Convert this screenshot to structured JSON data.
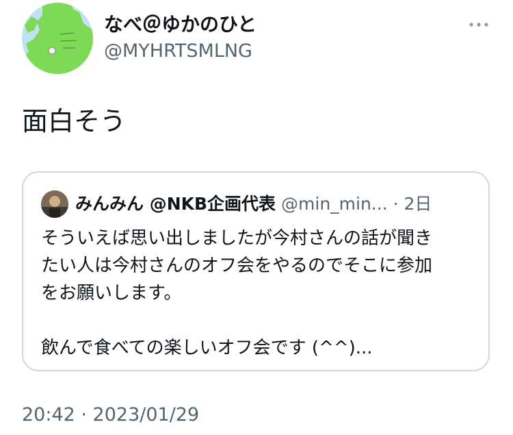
{
  "author": {
    "display_name": "なべ＠ゆかのひと",
    "handle": "@MYHRTSMLNG",
    "avatar_icon": "map-avatar-icon"
  },
  "tweet": {
    "text": "面白そう",
    "timestamp": "20:42 · 2023/01/29"
  },
  "quoted_tweet": {
    "display_name": "みんみん @NKB企画代表",
    "handle": "@min_min...",
    "separator": "·",
    "time": "2日",
    "lines": [
      "そういえば思い出しましたが今村さんの話が聞き",
      "たい人は今村さんのオフ会をやるのでそこに参加",
      "をお願いします。",
      "",
      "飲んで食べての楽しいオフ会です (^^)..."
    ]
  },
  "colors": {
    "text": "#0f1419",
    "secondary": "#536471",
    "border": "#cfd9de",
    "avatar_map_green": "#7ed957",
    "avatar_sky": "#bfe3f2"
  }
}
